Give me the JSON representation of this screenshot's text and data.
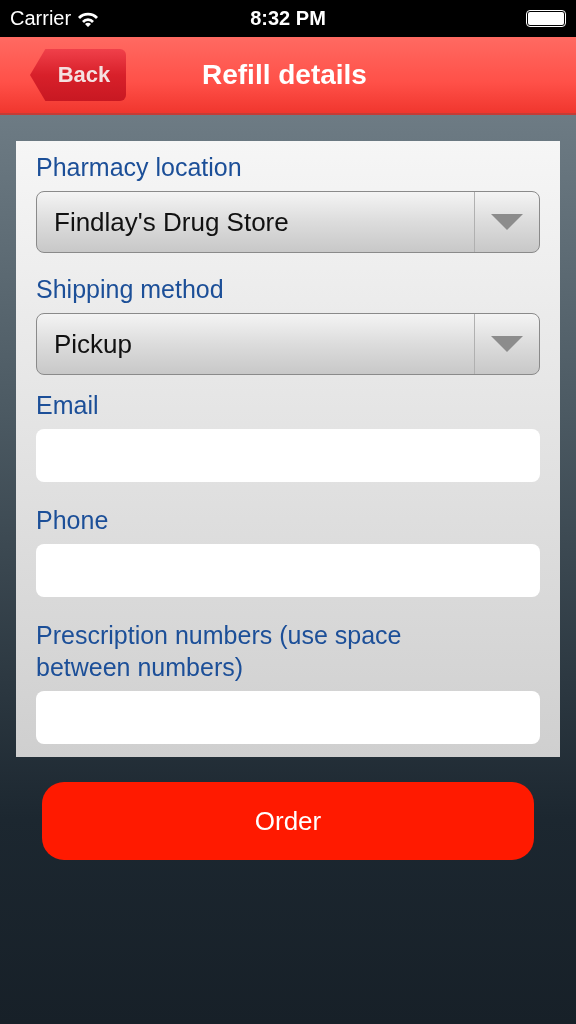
{
  "status_bar": {
    "carrier": "Carrier",
    "time": "8:32 PM"
  },
  "nav_bar": {
    "back": "Back",
    "title": "Refill details"
  },
  "fields": [
    {
      "kind": "select",
      "label": "Pharmacy location",
      "value": "Findlay's Drug Store"
    },
    {
      "kind": "select",
      "label": "Shipping method",
      "value": "Pickup"
    },
    {
      "kind": "text",
      "label": "Email"
    },
    {
      "kind": "text",
      "label": "Phone"
    },
    {
      "kind": "text",
      "label": "Prescription numbers (use space between numbers)"
    }
  ],
  "order_button": "Order"
}
